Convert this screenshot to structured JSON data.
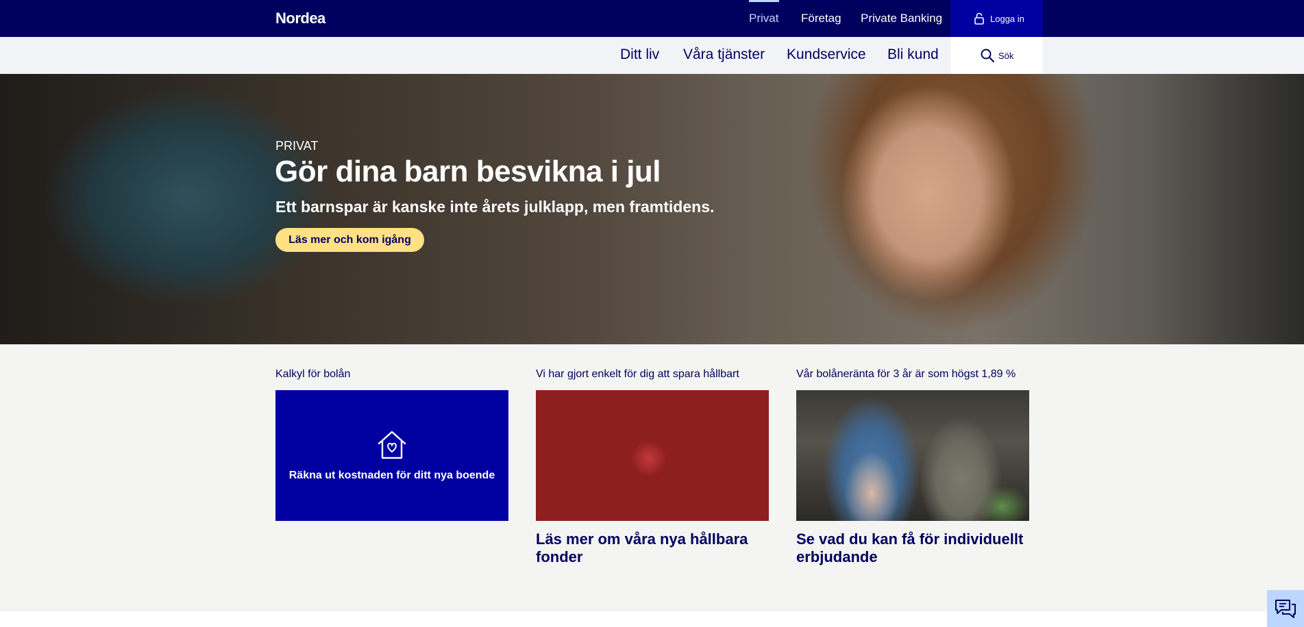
{
  "header": {
    "logo": "Nordea",
    "top_nav": [
      {
        "label": "Privat",
        "active": true
      },
      {
        "label": "Företag",
        "active": false
      },
      {
        "label": "Private Banking",
        "active": false
      }
    ],
    "login_label": "Logga in",
    "login_icon": "lock-icon",
    "sub_nav": [
      {
        "label": "Ditt liv"
      },
      {
        "label": "Våra tjänster"
      },
      {
        "label": "Kundservice"
      },
      {
        "label": "Bli kund"
      }
    ],
    "search_label": "Sök",
    "search_icon": "search-icon"
  },
  "hero": {
    "eyebrow": "PRIVAT",
    "title": "Gör dina barn besvikna i jul",
    "subtitle": "Ett barnspar är kanske inte årets julklapp, men framtidens.",
    "button_label": "Läs mer och kom igång"
  },
  "cards": [
    {
      "label": "Kalkyl för bolån",
      "media_text": "Räkna ut kostnaden för ditt nya boende",
      "icon": "house-heart-icon"
    },
    {
      "label": "Vi har gjort enkelt för dig att spara hållbart",
      "title": "Läs mer om våra nya hållbara fonder"
    },
    {
      "label": "Vår bolåneränta för 3 år är som högst 1,89 %",
      "title": "Se vad du kan få för individuellt erbjudande"
    }
  ],
  "chat_icon": "chat-icon",
  "colors": {
    "brand_dark": "#00005e",
    "brand_blue": "#0000a0",
    "accent_yellow": "#ffe183",
    "light_blue": "#bcd7ff"
  }
}
